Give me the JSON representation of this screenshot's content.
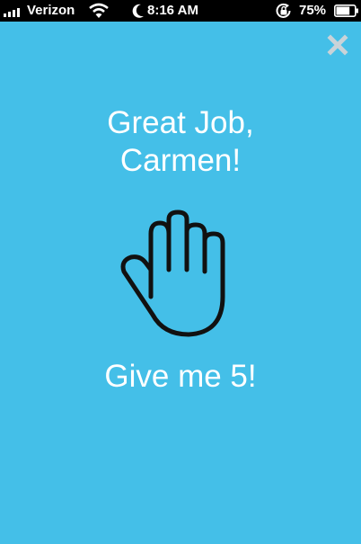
{
  "status_bar": {
    "carrier": "Verizon",
    "time": "8:16 AM",
    "battery_percent": "75%",
    "signal_icon": "signal-bars-icon",
    "wifi_icon": "wifi-icon",
    "dnd_icon": "moon-icon",
    "orientation_lock_icon": "rotation-lock-icon",
    "battery_icon": "battery-icon",
    "battery_level": 0.75
  },
  "colors": {
    "background": "#44bfe8",
    "text": "#ffffff",
    "close_icon": "#c9d3d8",
    "hand_fill": "#44bfe8",
    "hand_outline": "#111111"
  },
  "close_button": {
    "icon": "close-icon"
  },
  "message": {
    "line1": "Great Job,",
    "line2": "Carmen!",
    "illustration": "raised-hand-icon",
    "cta": "Give me 5!"
  }
}
